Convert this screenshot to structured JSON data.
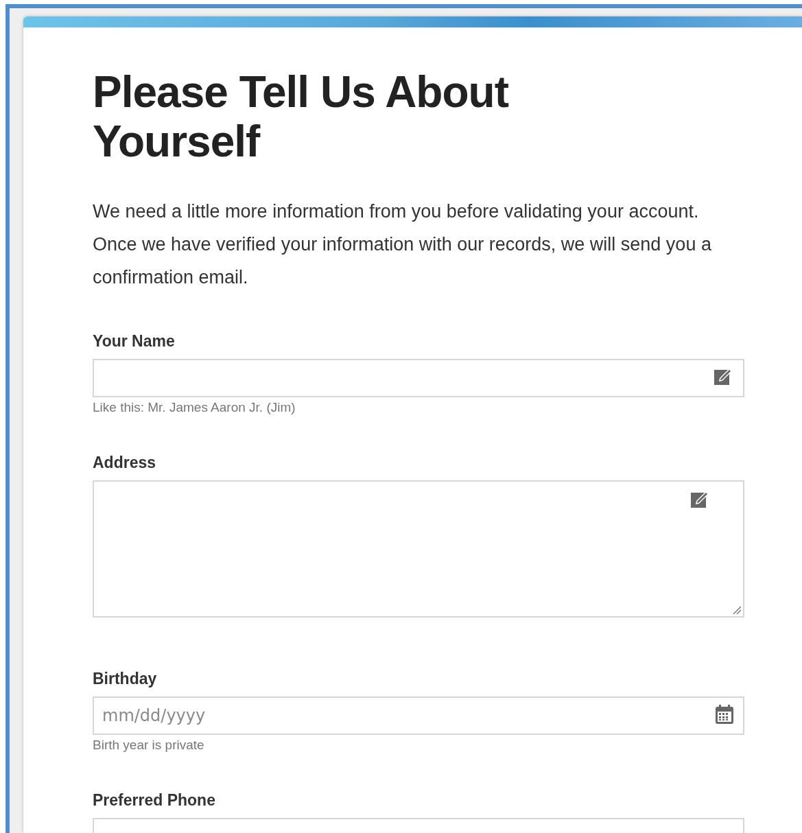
{
  "title": "Please Tell Us About Yourself",
  "intro": "We need a little more information from you before validating your account. Once we have verified your information with our records, we will send you a confirmation email.",
  "fields": [
    {
      "kind": "text",
      "label": "Your Name",
      "hint": "Like this: Mr. James Aaron Jr. (Jim)"
    },
    {
      "kind": "textarea",
      "label": "Address"
    },
    {
      "kind": "date",
      "label": "Birthday",
      "placeholder": "mm/dd/yyyy",
      "hint": "Birth year is private"
    },
    {
      "kind": "phone",
      "label": "Preferred Phone"
    }
  ]
}
